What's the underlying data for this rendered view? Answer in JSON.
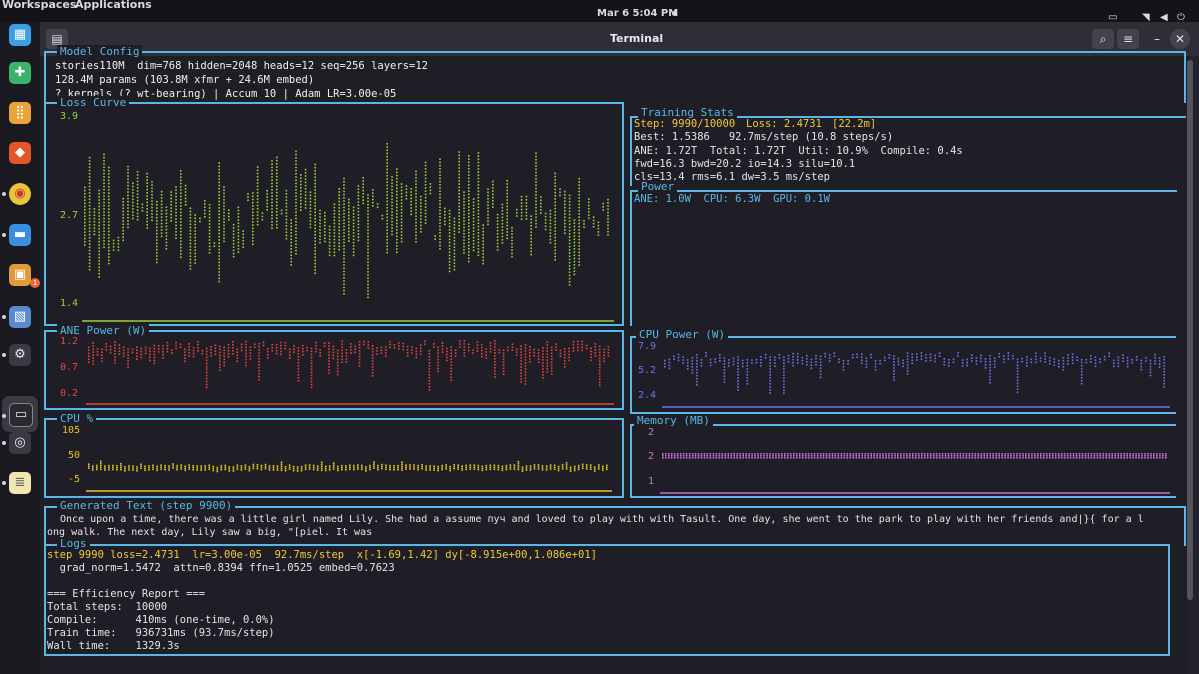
{
  "topbar": {
    "workspaces": "Workspaces",
    "applications": "Applications",
    "clock": "Mar 6   5:04 PM"
  },
  "window": {
    "title": "Terminal"
  },
  "model_config": {
    "title": "Model Config",
    "lines": [
      "stories110M  dim=768 hidden=2048 heads=12 seq=256 layers=12",
      "128.4M params (103.8M xfmr + 24.6M embed)",
      "? kernels (? wt-bearing) | Accum 10 | Adam LR=3.00e-05"
    ]
  },
  "loss_curve": {
    "title": "Loss Curve",
    "ticks": [
      "3.9",
      "2.7",
      "1.4"
    ],
    "color": "#9bd23c"
  },
  "training_stats": {
    "title": "Training Stats",
    "step": "Step: 9990/10000",
    "loss": "Loss: 2.4731",
    "time": "[22.2m]",
    "lines": [
      "Best: 1.5386   92.7ms/step (10.8 steps/s)",
      "ANE: 1.72T  Total: 1.72T  Util: 10.9%  Compile: 0.4s",
      "fwd=16.3 bwd=20.2 io=14.3 silu=10.1",
      "cls=13.4 rms=6.1 dw=3.5 ms/step"
    ]
  },
  "power": {
    "title": "Power",
    "text": "ANE: 1.0W  CPU: 6.3W  GPU: 0.1W"
  },
  "ane_power": {
    "title": "ANE Power (W)",
    "ticks": [
      "1.2",
      "0.7",
      "0.2"
    ],
    "color": "#e2473f"
  },
  "cpu_power": {
    "title": "CPU Power (W)",
    "ticks": [
      "7.9",
      "5.2",
      "2.4"
    ],
    "color": "#6c74e8"
  },
  "cpu_pct": {
    "title": "CPU %",
    "ticks": [
      "105",
      "50",
      "-5"
    ],
    "color": "#e6c42c"
  },
  "memory": {
    "title": "Memory (MB)",
    "ticks": [
      "2",
      "2",
      "1"
    ],
    "color": "#c86fd8"
  },
  "generated": {
    "title": "Generated Text (step 9900)",
    "lines": [
      "Once upon a time, there was a little girl named Lily. She had a assume пуч and loved to play with with Tasult. One day, she went to the park to play with her friends and|}{ for a l",
      "ong walk. The next day, Lily saw a big, \"[piel. It was"
    ]
  },
  "logs": {
    "title": "Logs",
    "step_line": "step 9990 loss=2.4731  lr=3.00e-05  92.7ms/step  x[-1.69,1.42] dy[-8.915e+00,1.086e+01]",
    "grad_line": "  grad_norm=1.5472  attn=0.8394 ffn=1.0525 embed=0.7623",
    "report_title": "=== Efficiency Report ===",
    "report": [
      "Total steps:  10000",
      "Compile:      410ms (one-time, 0.0%)",
      "Train time:   936731ms (93.7ms/step)",
      "Wall time:    1329.3s"
    ]
  },
  "colors": {
    "border": "#58b7e6",
    "title_text": "#58b7e6",
    "stats_highlight": "#f3c83a"
  }
}
